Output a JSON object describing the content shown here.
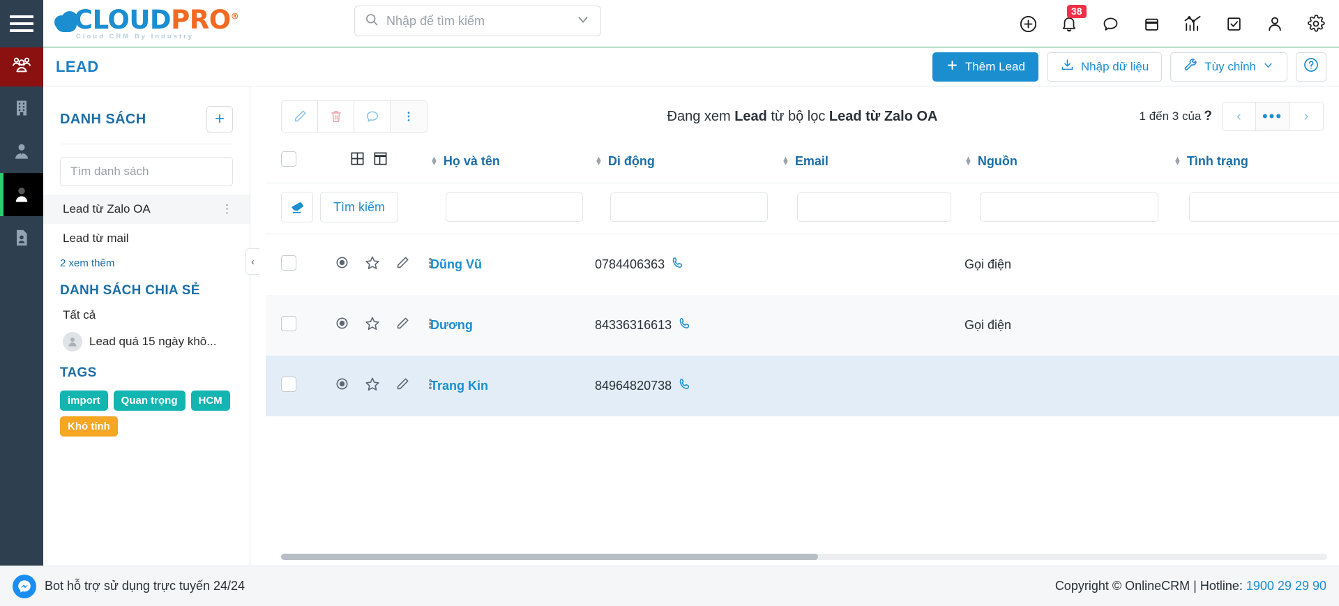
{
  "brand": {
    "name_cloud": "CLOUD",
    "name_pro": "PRO",
    "registered": "®",
    "tagline": "Cloud CRM By Industry"
  },
  "topbar": {
    "search_placeholder": "Nhập để tìm kiếm",
    "notification_count": "38",
    "icons": [
      "plus-circle-icon",
      "bell-icon",
      "chat-icon",
      "calendar-icon",
      "analytics-icon",
      "task-icon",
      "user-icon",
      "gear-icon"
    ]
  },
  "secondbar": {
    "page_title": "LEAD",
    "add_lead_label": "Thêm Lead",
    "import_label": "Nhập dữ liệu",
    "customize_label": "Tùy chỉnh",
    "help_label": "?"
  },
  "list_panel": {
    "title": "DANH SÁCH",
    "add_label": "+",
    "search_placeholder": "Tìm danh sách",
    "items": [
      {
        "label": "Lead từ Zalo OA",
        "selected": true
      },
      {
        "label": "Lead từ mail",
        "selected": false
      }
    ],
    "more_label": "2 xem thêm",
    "shared_title": "DANH SÁCH CHIA SẺ",
    "shared_all": "Tất cả",
    "shared_item": "Lead quá 15 ngày khô...",
    "tags_title": "TAGS",
    "tags": [
      {
        "label": "import",
        "color": "#13b5b1"
      },
      {
        "label": "Quan trọng",
        "color": "#13b5b1"
      },
      {
        "label": "HCM",
        "color": "#13b5b1"
      },
      {
        "label": "Khó tính",
        "color": "#f5a623"
      }
    ]
  },
  "main": {
    "toolbar_icons": [
      "edit-icon",
      "trash-icon",
      "comment-icon",
      "more-vertical-icon"
    ],
    "view_label_prefix": "Đang xem ",
    "view_label_entity": "Lead",
    "view_label_middle": " từ bộ lọc ",
    "view_label_filter": "Lead từ Zalo OA",
    "pager_text": "1 đến 3 của",
    "pager_unknown": "?",
    "pager_prev": "‹",
    "pager_more": "•••",
    "pager_next": "›",
    "columns": [
      {
        "key": "name",
        "label": "Họ và tên"
      },
      {
        "key": "mobile",
        "label": "Di động"
      },
      {
        "key": "email",
        "label": "Email"
      },
      {
        "key": "source",
        "label": "Nguồn"
      },
      {
        "key": "status",
        "label": "Tình trạng"
      }
    ],
    "filter": {
      "eraser_label": "eraser-icon",
      "search_label": "Tìm kiếm"
    },
    "rows": [
      {
        "name": "Dũng Vũ",
        "mobile": "0784406363",
        "email": "",
        "source": "Gọi điện",
        "status": "",
        "highlight": "none"
      },
      {
        "name": "Dương",
        "mobile": "84336316613",
        "email": "",
        "source": "Gọi điện",
        "status": "",
        "highlight": "alt"
      },
      {
        "name": "Trang Kin",
        "mobile": "84964820738",
        "email": "",
        "source": "",
        "status": "",
        "highlight": "sel"
      }
    ]
  },
  "footer": {
    "bot_label": "Bot hỗ trợ sử dụng trực tuyến 24/24",
    "copyright": "Copyright © OnlineCRM",
    "separator": " | ",
    "hotline_label": "Hotline: ",
    "hotline_number": "1900 29 29 90"
  }
}
